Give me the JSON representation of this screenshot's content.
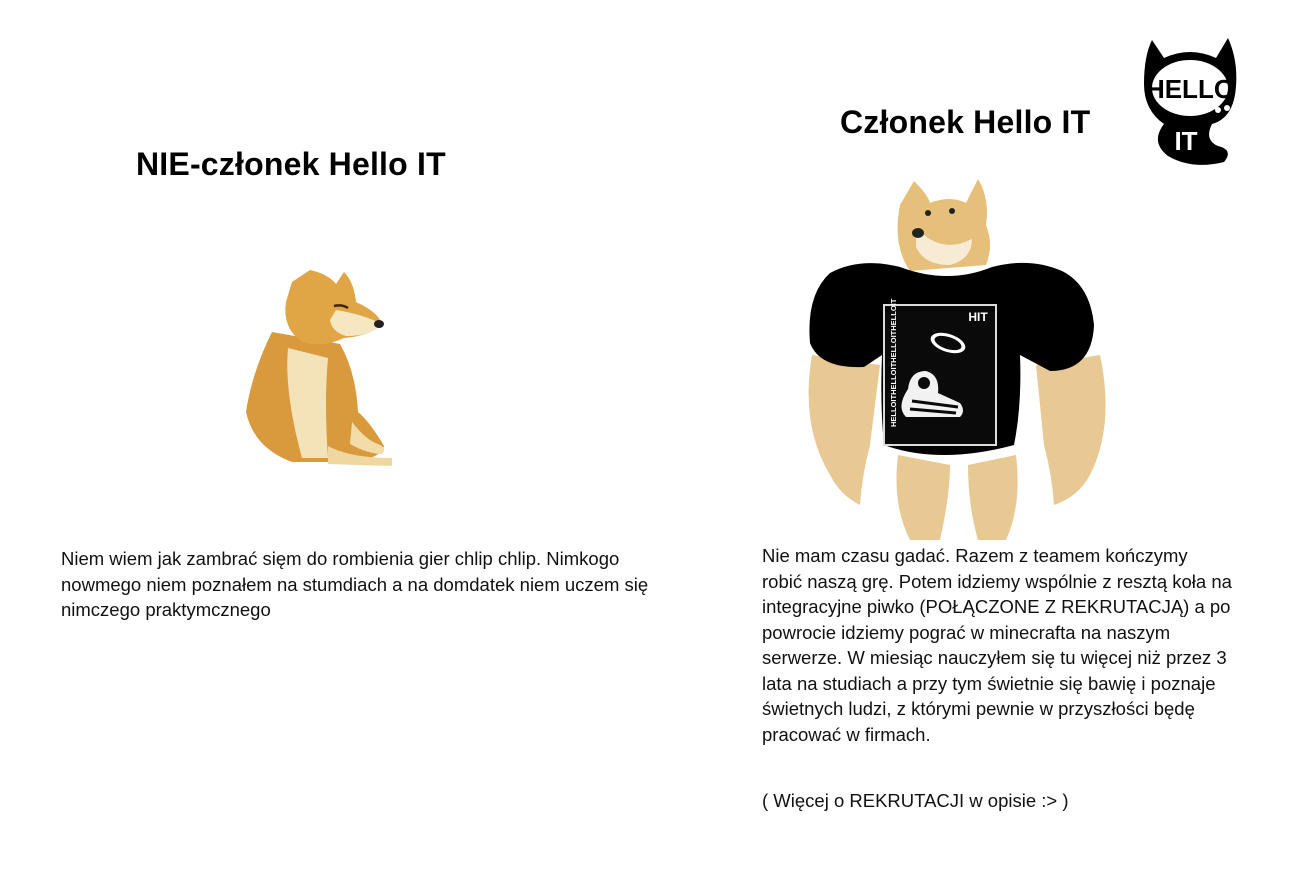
{
  "left": {
    "heading": "NIE-członek Hello IT",
    "text": "Niem wiem jak zambrać sięm do rombienia gier chlip chlip. Nimkogo nowmego niem poznałem na stumdiach a na domdatek niem uczem się nimczego praktymcznego"
  },
  "right": {
    "heading": "Członek Hello IT",
    "text": "Nie mam czasu gadać. Razem z teamem kończymy robić naszą grę. Potem idziemy wspólnie z resztą koła na integracyjne piwko (POŁĄCZONE Z REKRUTACJĄ) a po powrocie idziemy pograć w minecrafta na naszym serwerze. W miesiąc nauczyłem się tu więcej niż przez 3 lata na studiach a przy tym świetnie się bawię i poznaje świetnych ludzi, z którymi pewnie w przyszłości będę pracować w firmach.",
    "note": "( Więcej o REKRUTACJI w opisie :> )"
  },
  "logo": {
    "top_text": "HELLO",
    "bottom_text": "IT"
  },
  "shirt": {
    "print_label": "HIT",
    "side_text": "HELLOITHELLOITHELLOITHELLOIT"
  },
  "colors": {
    "background": "#ffffff",
    "text": "#111111",
    "doge_fur": "#e0ad55",
    "buff_fur": "#e8c994",
    "shirt": "#000000"
  }
}
